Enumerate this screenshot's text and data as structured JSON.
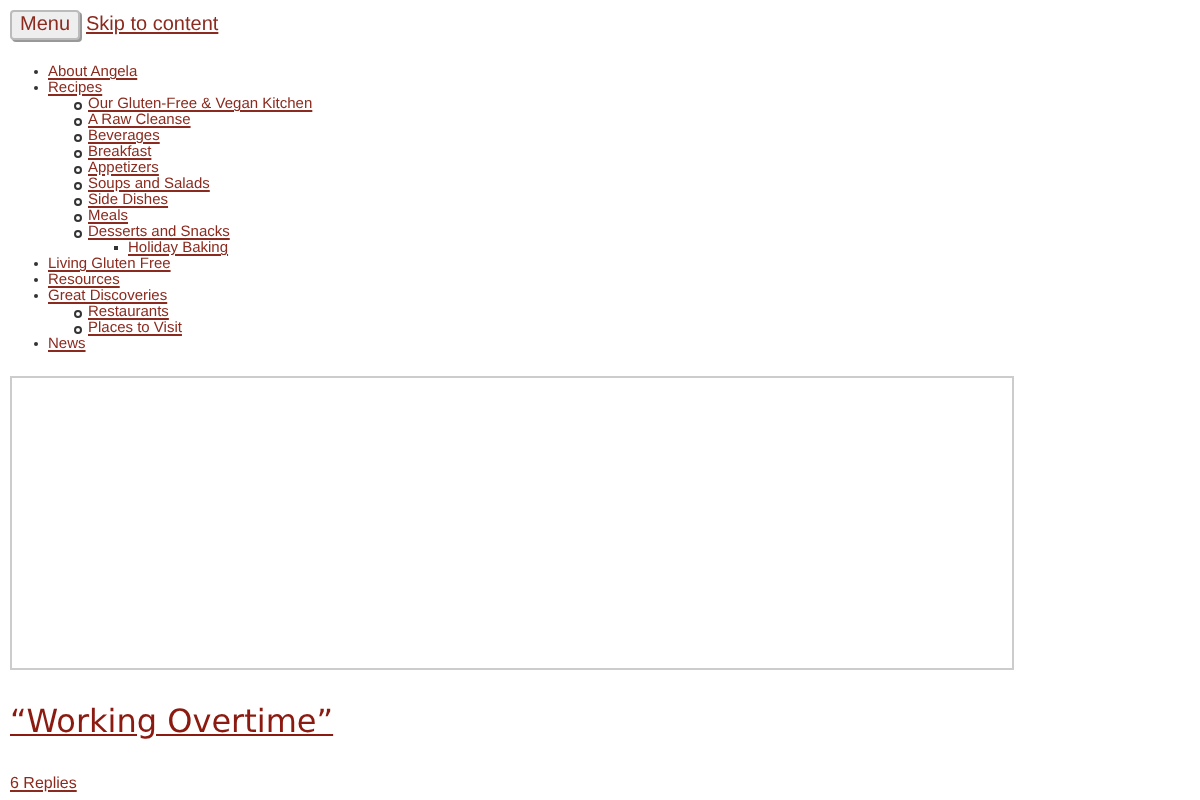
{
  "menu_button": "Menu",
  "skip_link": "Skip to content",
  "nav": [
    {
      "label": "About Angela"
    },
    {
      "label": "Recipes",
      "children": [
        {
          "label": "Our Gluten-Free & Vegan Kitchen"
        },
        {
          "label": "A Raw Cleanse"
        },
        {
          "label": "Beverages"
        },
        {
          "label": "Breakfast"
        },
        {
          "label": "Appetizers"
        },
        {
          "label": "Soups and Salads"
        },
        {
          "label": "Side Dishes"
        },
        {
          "label": "Meals"
        },
        {
          "label": "Desserts and Snacks",
          "children": [
            {
              "label": "Holiday Baking"
            }
          ]
        }
      ]
    },
    {
      "label": "Living Gluten Free"
    },
    {
      "label": "Resources"
    },
    {
      "label": "Great Discoveries",
      "children": [
        {
          "label": "Restaurants"
        },
        {
          "label": "Places to Visit"
        }
      ]
    },
    {
      "label": "News"
    }
  ],
  "post": {
    "title": "“Working Overtime”",
    "replies": "6 Replies"
  }
}
